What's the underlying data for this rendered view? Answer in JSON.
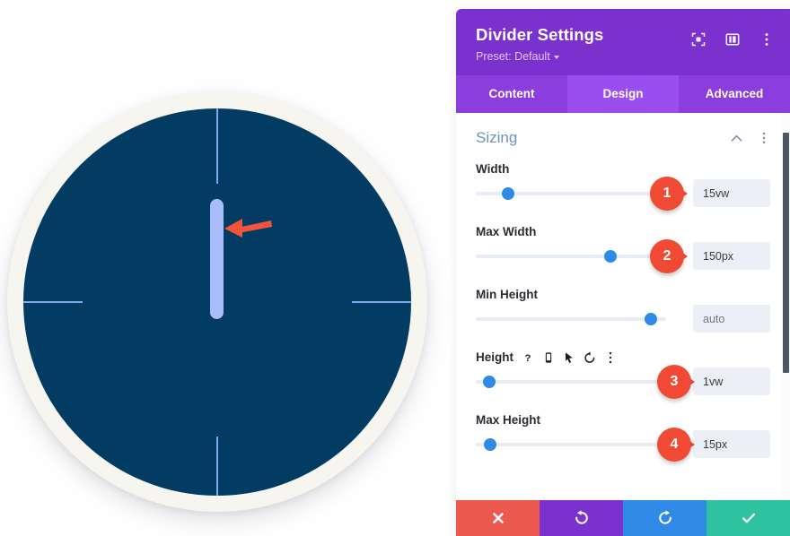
{
  "panel": {
    "title": "Divider Settings",
    "preset_label": "Preset: Default",
    "header_icons": [
      {
        "name": "focus-icon"
      },
      {
        "name": "layout-columns-icon"
      },
      {
        "name": "more-vertical-icon"
      }
    ],
    "tabs": [
      {
        "label": "Content",
        "active": false
      },
      {
        "label": "Design",
        "active": true
      },
      {
        "label": "Advanced",
        "active": false
      }
    ],
    "section": {
      "title": "Sizing",
      "collapse_icon": "chevron-up-icon",
      "menu_icon": "more-vertical-icon"
    },
    "fields": [
      {
        "label": "Width",
        "value": "15vw",
        "placeholder": "",
        "is_placeholder": false,
        "slider_pct": 17,
        "callout": "1",
        "icons": []
      },
      {
        "label": "Max Width",
        "value": "150px",
        "placeholder": "",
        "is_placeholder": false,
        "slider_pct": 69,
        "callout": "2",
        "icons": []
      },
      {
        "label": "Min Height",
        "value": "",
        "placeholder": "auto",
        "is_placeholder": true,
        "slider_pct": 90,
        "callout": "",
        "icons": []
      },
      {
        "label": "Height",
        "value": "1vw",
        "placeholder": "",
        "is_placeholder": false,
        "slider_pct": 4,
        "callout": "3",
        "icons": [
          "help-icon",
          "mobile-icon",
          "cursor-icon",
          "reset-icon",
          "more-vertical-icon"
        ]
      },
      {
        "label": "Max Height",
        "value": "15px",
        "placeholder": "",
        "is_placeholder": false,
        "slider_pct": 4,
        "callout": "4",
        "icons": []
      }
    ],
    "footer_buttons": [
      {
        "name": "cancel-button",
        "icon": "close-icon"
      },
      {
        "name": "undo-button",
        "icon": "undo-icon"
      },
      {
        "name": "redo-button",
        "icon": "redo-icon"
      },
      {
        "name": "save-button",
        "icon": "check-icon"
      }
    ]
  },
  "canvas": {
    "preview_name": "divider-clock-preview",
    "ring_color": "#f7f5f0",
    "face_color": "#033c63",
    "tick_color": "#7ea6f2",
    "divider_color": "#a9bdfa",
    "arrow_color": "#f04a34"
  },
  "colors": {
    "brand_purple": "#7b31cd",
    "tab_purple": "#8b3ddd",
    "tab_active_purple": "#9b4ef0",
    "callout_red": "#f04a34",
    "slider_blue": "#2e8ae6",
    "save_teal": "#2fc2a0"
  }
}
